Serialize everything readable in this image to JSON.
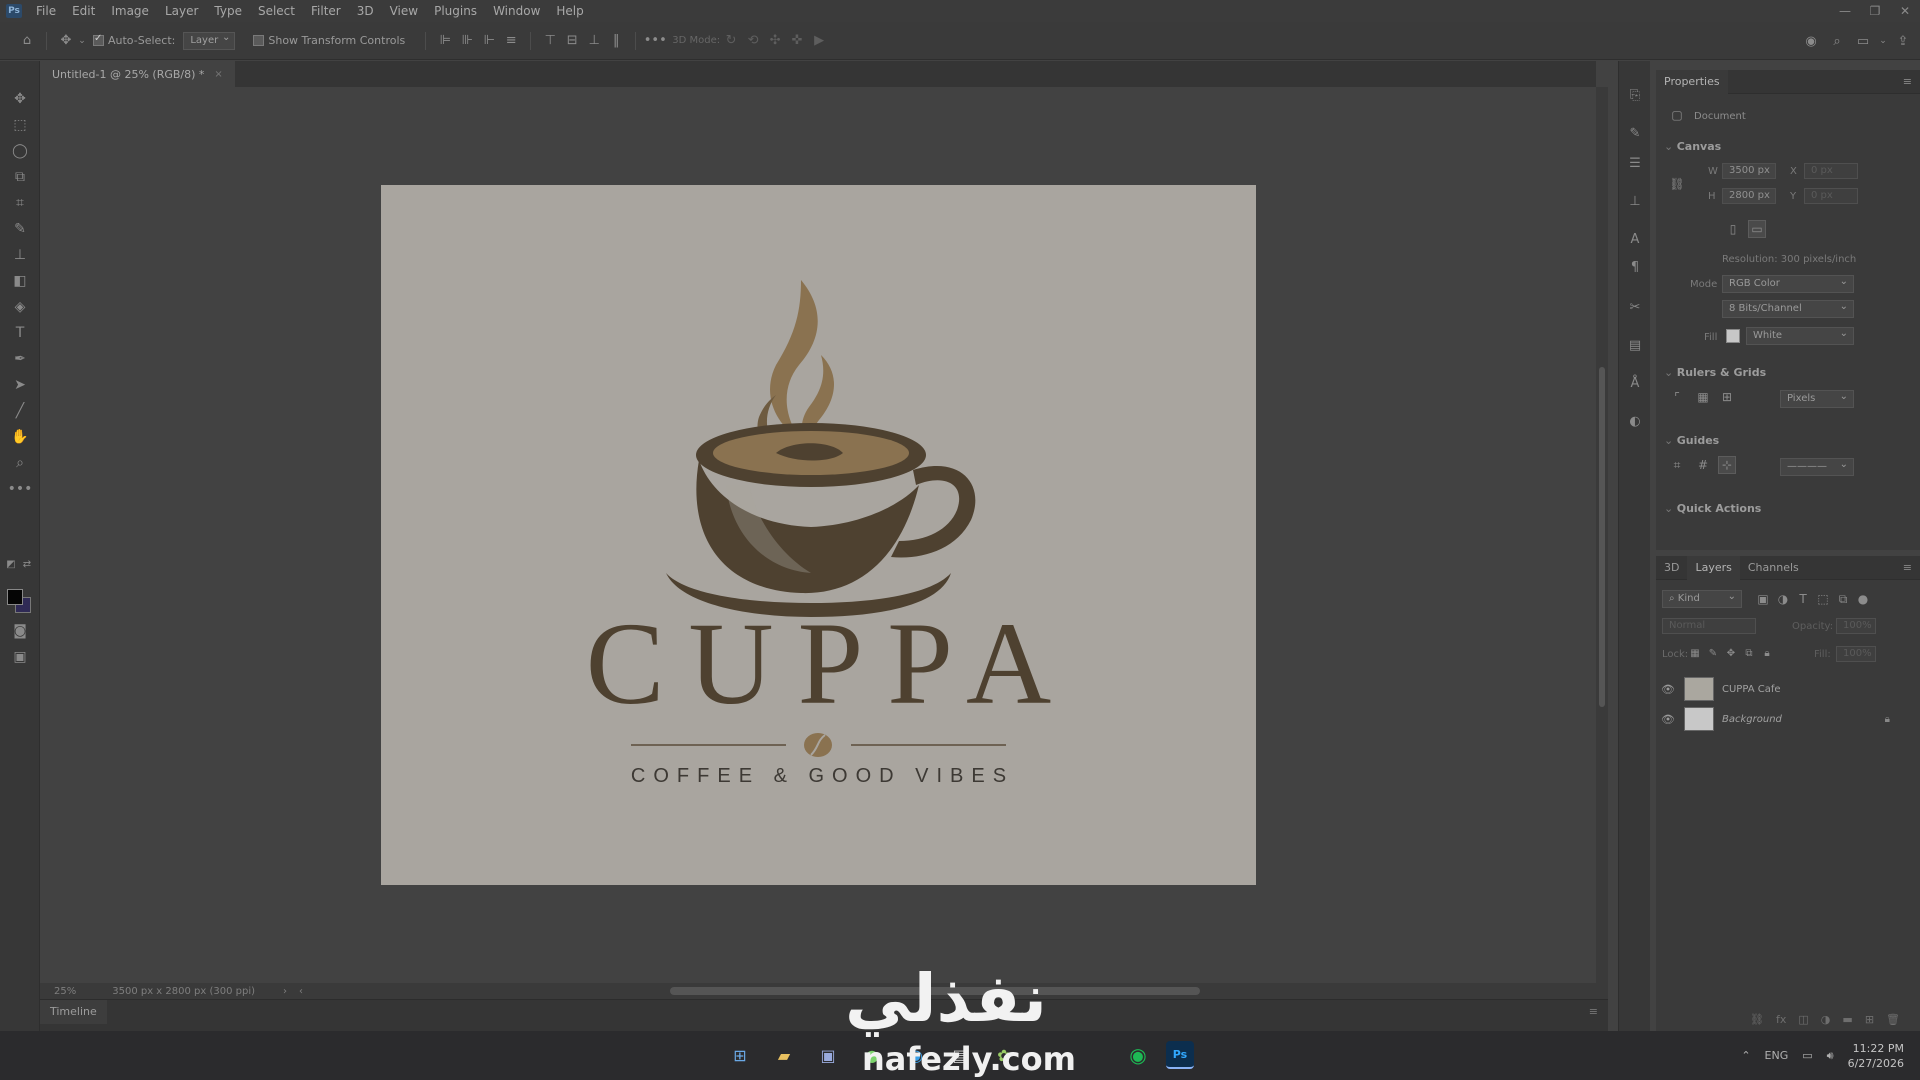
{
  "app": {
    "logo": "Ps",
    "menu": [
      "File",
      "Edit",
      "Image",
      "Layer",
      "Type",
      "Select",
      "Filter",
      "3D",
      "View",
      "Plugins",
      "Window",
      "Help"
    ]
  },
  "options_bar": {
    "auto_select_label": "Auto-Select:",
    "auto_select_checked": true,
    "auto_select_target": "Layer",
    "transform_controls_label": "Show Transform Controls",
    "transform_controls_checked": false,
    "mode_3d_label": "3D Mode:"
  },
  "document": {
    "tab_title": "Untitled-1 @ 25% (RGB/8) *",
    "tab_close": "×",
    "artwork": {
      "brand_name": "CUPPA",
      "tagline": "COFFEE & GOOD VIBES",
      "brown": "#4e4130",
      "gold": "#8a7250",
      "background": "#a9a59f"
    }
  },
  "status_bar": {
    "zoom": "25%",
    "doc_size": "3500 px x 2800 px (300 ppi)"
  },
  "timeline": {
    "label": "Timeline"
  },
  "properties": {
    "panel_title": "Properties",
    "doc_type": "Document",
    "canvas_section": "Canvas",
    "width_label": "W",
    "width_value": "3500 px",
    "height_label": "H",
    "height_value": "2800 px",
    "x_label": "X",
    "x_value": "0 px",
    "y_label": "Y",
    "y_value": "0 px",
    "resolution": "Resolution: 300 pixels/inch",
    "mode_label": "Mode",
    "mode_value": "RGB Color",
    "bit_depth": "8 Bits/Channel",
    "fill_label": "Fill",
    "fill_value": "White",
    "rulers_section": "Rulers & Grids",
    "units_value": "Pixels",
    "guides_section": "Guides",
    "guide_style": "————",
    "quick_actions_section": "Quick Actions"
  },
  "layers_panel": {
    "tabs": [
      "3D",
      "Layers",
      "Channels"
    ],
    "active_tab": "Layers",
    "filter_kind": "Kind",
    "blend_mode": "Normal",
    "opacity_label": "Opacity:",
    "opacity_value": "100%",
    "lock_label": "Lock:",
    "fill_label": "Fill:",
    "fill_value": "100%",
    "layers": [
      {
        "name": "CUPPA Cafe",
        "visible": true,
        "locked": false
      },
      {
        "name": "Background",
        "visible": true,
        "locked": true
      }
    ]
  },
  "taskbar": {
    "tray_lang": "ENG",
    "time": "11:22 PM",
    "date": "6/27/2026"
  },
  "watermark": {
    "arabic": "نفذلي",
    "url": "nafezly.com"
  }
}
